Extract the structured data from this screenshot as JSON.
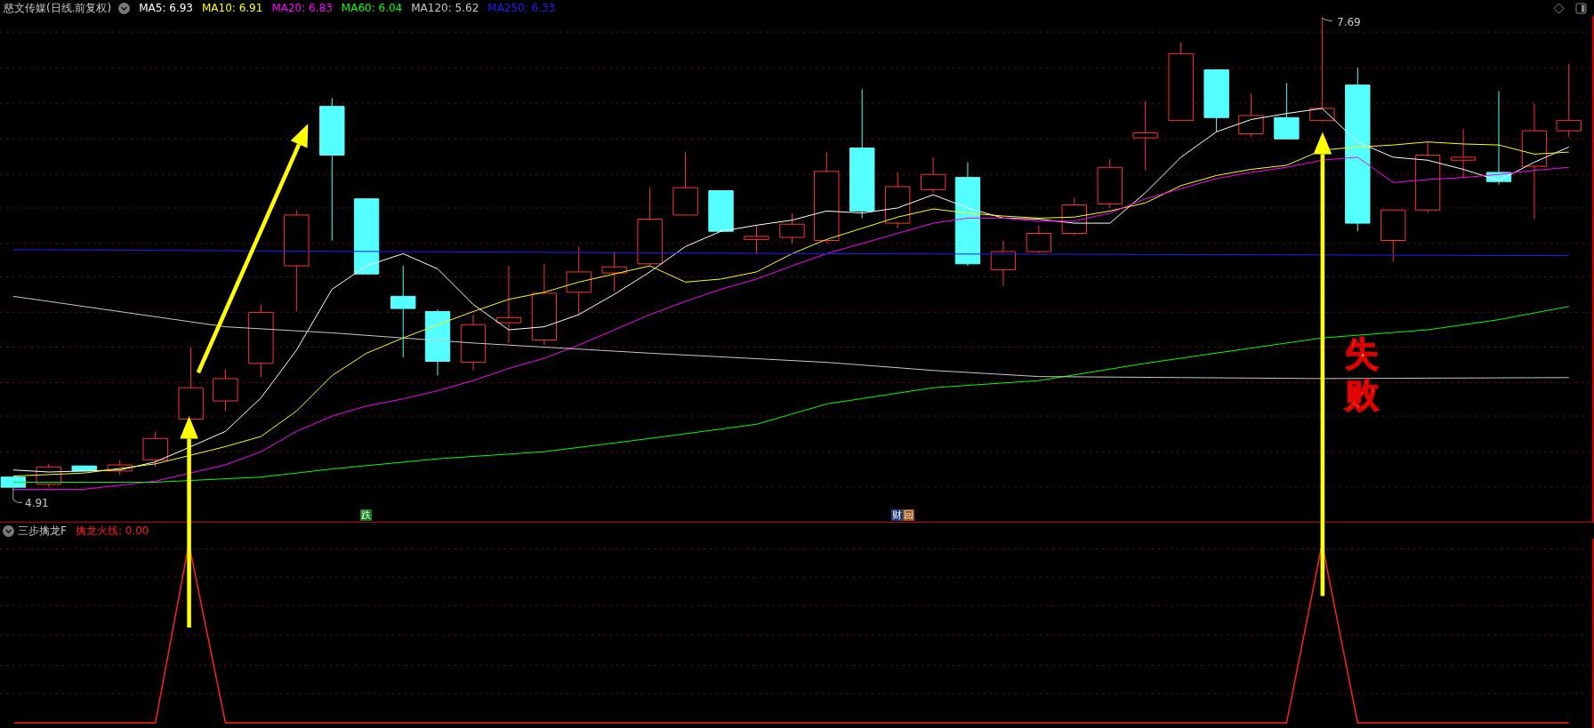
{
  "header": {
    "title": "慈文传媒(日线.前复权)",
    "moving_averages": [
      {
        "label": "MA5: 6.93",
        "color": "#ffffff"
      },
      {
        "label": "MA10: 6.91",
        "color": "#ffff00"
      },
      {
        "label": "MA20: 6.83",
        "color": "#ff00ff"
      },
      {
        "label": "MA60: 6.04",
        "color": "#00ff00"
      },
      {
        "label": "MA120: 5.62",
        "color": "#c8c8c8"
      },
      {
        "label": "MA250: 6.33",
        "color": "#2020ff"
      }
    ]
  },
  "price_labels": {
    "high": "7.69",
    "low": "4.91"
  },
  "signals": [
    {
      "chars": [
        {
          "text": "跌",
          "color": "#0b7d12"
        }
      ]
    },
    {
      "chars": [
        {
          "text": "财",
          "color": "#1c3d7a"
        },
        {
          "text": "回",
          "color": "#9a4e14"
        }
      ]
    }
  ],
  "annotation": "失败",
  "indicator_panel": {
    "name": "三步擒龙F",
    "reading": "擒龙火线: 0.00"
  }
}
